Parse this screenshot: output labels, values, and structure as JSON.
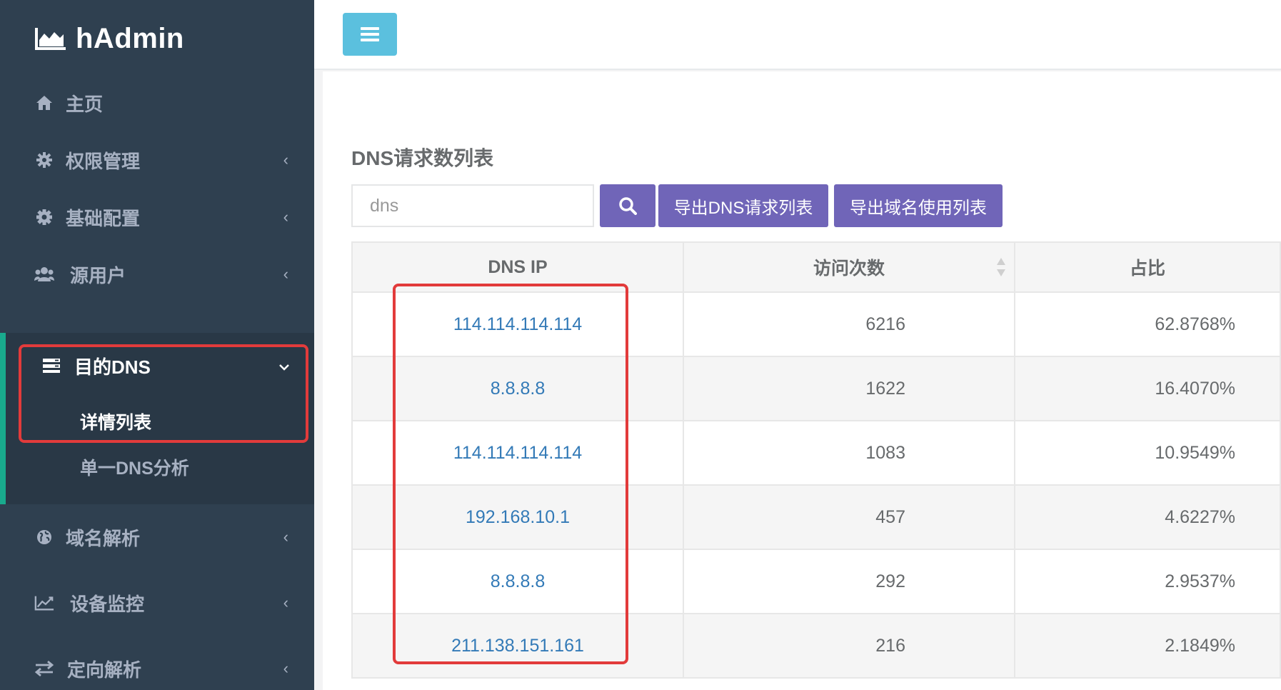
{
  "brand": {
    "name": "hAdmin",
    "icon": "area-chart-icon"
  },
  "sidebar": {
    "items": [
      {
        "label": "主页",
        "icon": "home-icon"
      },
      {
        "label": "权限管理",
        "icon": "gear-icon",
        "chevron": "‹"
      },
      {
        "label": "基础配置",
        "icon": "cog-icon",
        "chevron": "‹"
      },
      {
        "label": "源用户",
        "icon": "users-icon",
        "chevron": "‹"
      },
      {
        "label": "目的DNS",
        "icon": "server-icon",
        "chevron": "⌄",
        "expanded": true,
        "children": [
          {
            "label": "详情列表",
            "active": true
          },
          {
            "label": "单一DNS分析"
          }
        ]
      },
      {
        "label": "域名解析",
        "icon": "globe-icon",
        "chevron": "‹"
      },
      {
        "label": "设备监控",
        "icon": "line-chart-icon",
        "chevron": "‹"
      },
      {
        "label": "定向解析",
        "icon": "exchange-icon",
        "chevron": "‹"
      }
    ]
  },
  "topbar": {
    "menu_icon": "hamburger-icon"
  },
  "main": {
    "title": "DNS请求数列表",
    "search": {
      "value": "",
      "placeholder": "dns",
      "button_icon": "search-icon"
    },
    "buttons": {
      "export_dns": "导出DNS请求列表",
      "export_domain": "导出域名使用列表"
    },
    "table": {
      "headers": [
        "DNS IP",
        "访问次数",
        "占比"
      ],
      "rows": [
        {
          "ip": "114.114.114.114",
          "count": "6216",
          "pct": "62.8768%"
        },
        {
          "ip": "8.8.8.8",
          "count": "1622",
          "pct": "16.4070%"
        },
        {
          "ip": "114.114.114.114",
          "count": "1083",
          "pct": "10.9549%"
        },
        {
          "ip": "192.168.10.1",
          "count": "457",
          "pct": "4.6227%"
        },
        {
          "ip": "8.8.8.8",
          "count": "292",
          "pct": "2.9537%"
        },
        {
          "ip": "211.138.151.161",
          "count": "216",
          "pct": "2.1849%"
        }
      ]
    }
  },
  "colors": {
    "sidebar_bg": "#2f4050",
    "accent_purple": "#7065b8",
    "menu_button": "#5bc0de",
    "link": "#337ab7",
    "highlight": "#e23b3b"
  }
}
